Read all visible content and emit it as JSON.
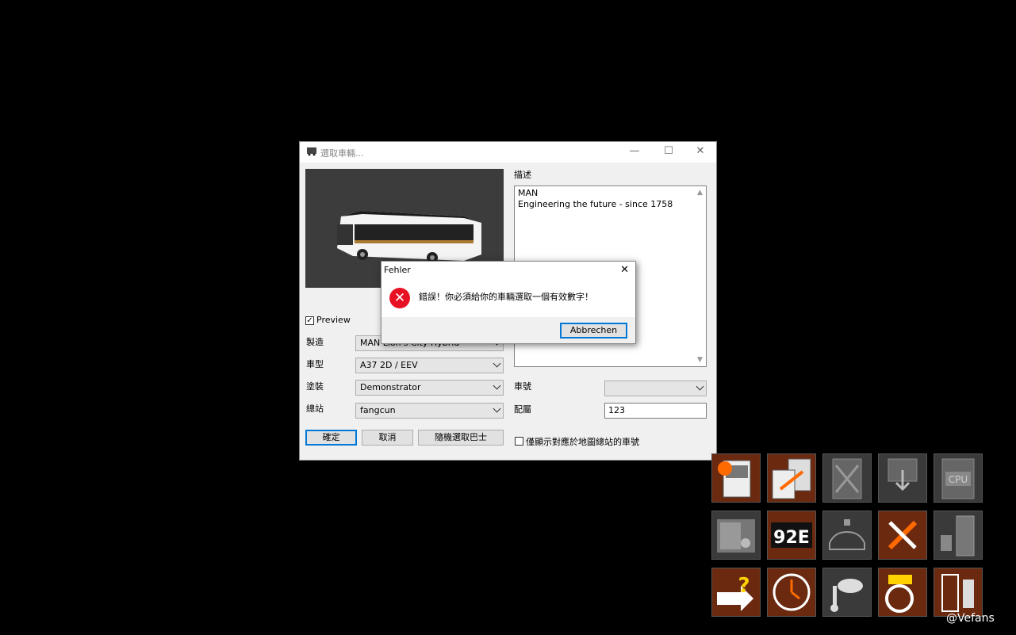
{
  "window": {
    "title": "選取車輛...",
    "minimize": "—",
    "maximize": "☐",
    "close": "✕"
  },
  "preview_label": "Preview",
  "preview_checked": true,
  "form": {
    "manufacturer_label": "製造",
    "manufacturer_value": "MAN Lion's City Hybrid",
    "model_label": "車型",
    "model_value": "A37 2D / EEV",
    "livery_label": "塗裝",
    "livery_value": "Demonstrator",
    "depot_label": "總站",
    "depot_value": "fangcun",
    "fleet_label": "車號",
    "fleet_value": "",
    "config_label": "配屬",
    "config_value": "123"
  },
  "buttons": {
    "ok": "確定",
    "cancel": "取消",
    "random": "隨機選取巴士"
  },
  "description": {
    "label": "描述",
    "line1": "MAN",
    "line2": "Engineering the future - since 1758"
  },
  "filter_checkbox_label": "僅顯示對應於地圖總站的車號",
  "error_dialog": {
    "title": "Fehler",
    "message": "錯誤！你必須給你的車輛選取一個有效數字！",
    "button": "Abbrechen"
  },
  "tiles": [
    {
      "icon": "bus-spark-icon",
      "bg": "#6b2a10"
    },
    {
      "icon": "bus-swap-icon",
      "bg": "#6b2a10"
    },
    {
      "icon": "bus-delete-icon",
      "bg": "#3a3a3a"
    },
    {
      "icon": "bus-remove-icon",
      "bg": "#3a3a3a"
    },
    {
      "icon": "bus-cpu-icon",
      "bg": "#3a3a3a"
    },
    {
      "icon": "timetable-icon",
      "bg": "#3a3a3a"
    },
    {
      "icon": "route-number-icon",
      "bg": "#6b2a10",
      "text": "92E"
    },
    {
      "icon": "accident-icon",
      "bg": "#3a3a3a"
    },
    {
      "icon": "repair-icon",
      "bg": "#6b2a10"
    },
    {
      "icon": "fuel-station-icon",
      "bg": "#3a3a3a"
    },
    {
      "icon": "help-icon",
      "bg": "#6b2a10"
    },
    {
      "icon": "clock-icon",
      "bg": "#6b2a10"
    },
    {
      "icon": "weather-icon",
      "bg": "#3a3a3a"
    },
    {
      "icon": "driving-icon",
      "bg": "#6b2a10"
    },
    {
      "icon": "checklist-icon",
      "bg": "#6b2a10"
    }
  ],
  "watermark": "@Vefans"
}
